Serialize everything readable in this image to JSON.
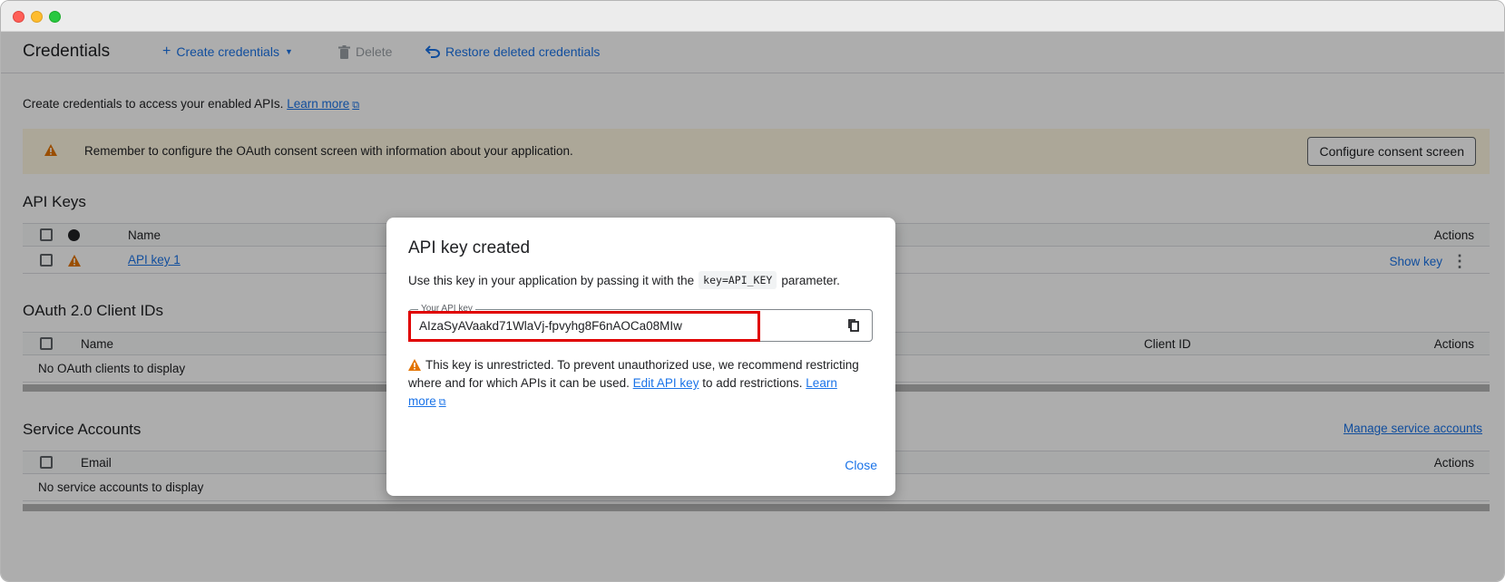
{
  "toolbar": {
    "title": "Credentials",
    "create_label": "Create credentials",
    "delete_label": "Delete",
    "restore_label": "Restore deleted credentials"
  },
  "intro": {
    "text": "Create credentials to access your enabled APIs.",
    "learn_more": "Learn more"
  },
  "banner": {
    "text": "Remember to configure the OAuth consent screen with information about your application.",
    "button": "Configure consent screen"
  },
  "api_keys": {
    "title": "API Keys",
    "col_name": "Name",
    "col_actions": "Actions",
    "rows": [
      {
        "name": "API key 1",
        "action": "Show key"
      }
    ]
  },
  "oauth": {
    "title": "OAuth 2.0 Client IDs",
    "col_name": "Name",
    "col_client_id": "Client ID",
    "col_actions": "Actions",
    "empty": "No OAuth clients to display"
  },
  "service_accounts": {
    "title": "Service Accounts",
    "manage_link": "Manage service accounts",
    "col_email": "Email",
    "col_actions": "Actions",
    "empty": "No service accounts to display"
  },
  "dialog": {
    "title": "API key created",
    "desc_before": "Use this key in your application by passing it with the",
    "desc_code": "key=API_KEY",
    "desc_after": "parameter.",
    "key_label": "Your API key",
    "key_value": "AIzaSyAVaakd71WlaVj-fpvyhg8F6nAOCa08MIw",
    "warn_1": "This key is unrestricted. To prevent unauthorized use, we recommend restricting where and for which APIs it can be used.",
    "edit_link": "Edit API key",
    "warn_2": "to add restrictions.",
    "learn_more": "Learn more",
    "close": "Close"
  },
  "colors": {
    "accent": "#1a73e8",
    "warning": "#e37400",
    "banner_bg": "#fef7e0",
    "highlight": "#e00000"
  }
}
